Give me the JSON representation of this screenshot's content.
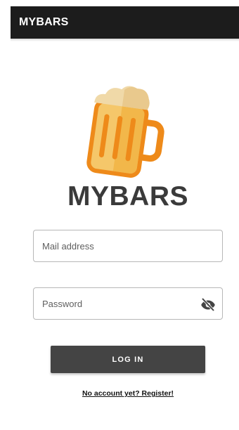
{
  "app_bar": {
    "title": "MYBARS"
  },
  "logo": {
    "icon": "beer-mug-icon",
    "text": "MYBARS"
  },
  "form": {
    "email": {
      "placeholder": "Mail address",
      "value": ""
    },
    "password": {
      "placeholder": "Password",
      "value": "",
      "toggle_icon": "eye-off-icon"
    },
    "login_label": "LOG IN",
    "register_label": "No account yet? Register!"
  },
  "colors": {
    "app_bar": "#1c1c1c",
    "button": "#444444",
    "logo_text": "#3a3a3a",
    "beer": "#f5c76a",
    "mug_outline": "#ee8a1a",
    "foam": "#f0d9a8"
  }
}
